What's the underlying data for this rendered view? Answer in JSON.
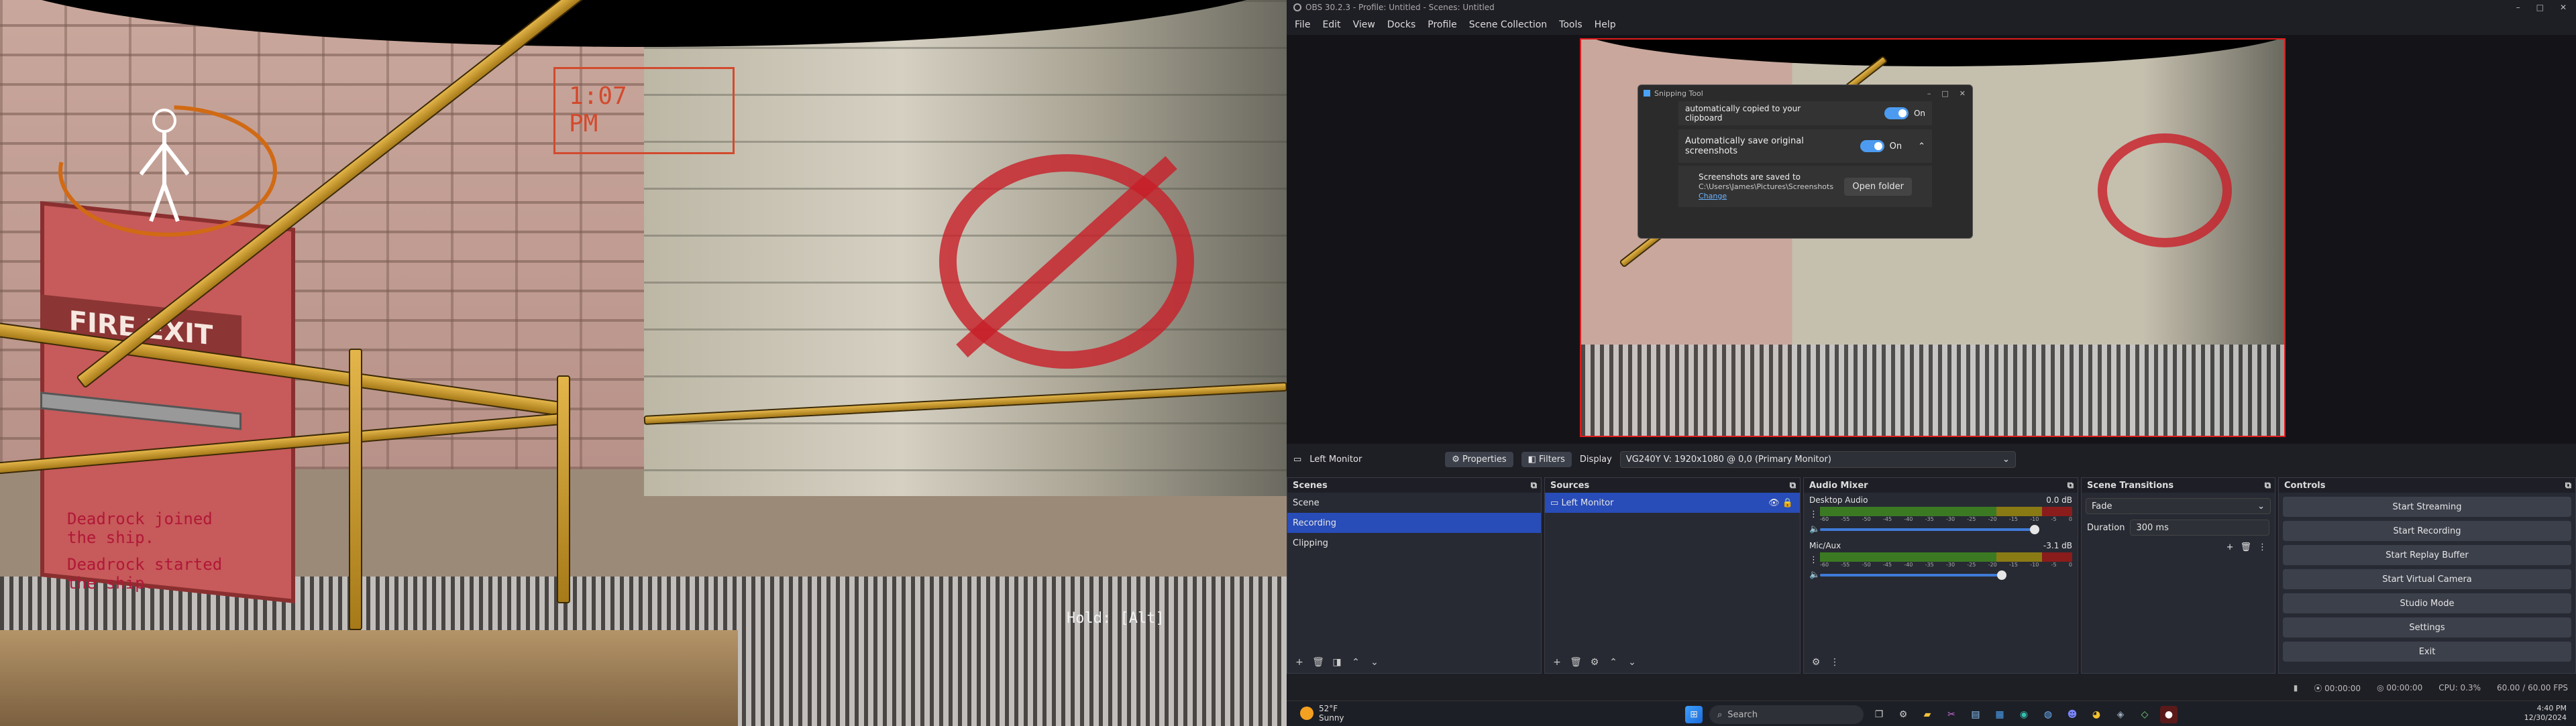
{
  "game": {
    "sign_fire_exit": "FIRE EXIT",
    "chat_line_1": "Deadrock joined",
    "chat_line_2": "the ship.",
    "chat_line_3": "Deadrock started",
    "chat_line_4": "the ship.",
    "hud_time_1": "1:07",
    "hud_time_2": "PM",
    "hold_hint": "Hold: [Alt]"
  },
  "obs": {
    "title": "OBS 30.2.3 - Profile: Untitled - Scenes: Untitled",
    "menu": [
      "File",
      "Edit",
      "View",
      "Docks",
      "Profile",
      "Scene Collection",
      "Tools",
      "Help"
    ],
    "source_bar": {
      "source_name": "Left Monitor",
      "properties": "Properties",
      "filters": "Filters",
      "display_label": "Display",
      "display_value": "VG240Y V: 1920x1080 @ 0,0 (Primary Monitor)"
    },
    "scenes": {
      "title": "Scenes",
      "items": [
        "Scene",
        "Recording",
        "Clipping"
      ],
      "selected": "Recording"
    },
    "sources": {
      "title": "Sources",
      "items": [
        "Left Monitor"
      ]
    },
    "audio": {
      "title": "Audio Mixer",
      "channels": [
        {
          "name": "Desktop Audio",
          "db": "0.0 dB",
          "level": 0.85
        },
        {
          "name": "Mic/Aux",
          "db": "-3.1 dB",
          "level": 0.72
        }
      ],
      "scale": [
        "-60",
        "-55",
        "-50",
        "-45",
        "-40",
        "-35",
        "-30",
        "-25",
        "-20",
        "-15",
        "-10",
        "-5",
        "0"
      ]
    },
    "transitions": {
      "title": "Scene Transitions",
      "type": "Fade",
      "duration_label": "Duration",
      "duration_value": "300 ms"
    },
    "controls": {
      "title": "Controls",
      "buttons": [
        "Start Streaming",
        "Start Recording",
        "Start Replay Buffer",
        "Start Virtual Camera",
        "Studio Mode",
        "Settings",
        "Exit"
      ]
    },
    "status": {
      "rec_time": "00:00:00",
      "stream_time": "00:00:00",
      "cpu": "CPU: 0.3%",
      "fps": "60.00 / 60.00 FPS"
    }
  },
  "snipping": {
    "title": "Snipping Tool",
    "row1_text": "automatically copied to your clipboard",
    "row1_state": "On",
    "row2_text": "Automatically save original screenshots",
    "row2_state": "On",
    "saved_label": "Screenshots are saved to",
    "saved_path": "C:\\Users\\James\\Pictures\\Screenshots",
    "change_link": "Change",
    "open_folder": "Open folder"
  },
  "taskbar": {
    "weather_temp": "52°F",
    "weather_desc": "Sunny",
    "search_placeholder": "Search",
    "time": "4:40 PM",
    "date": "12/30/2024"
  }
}
